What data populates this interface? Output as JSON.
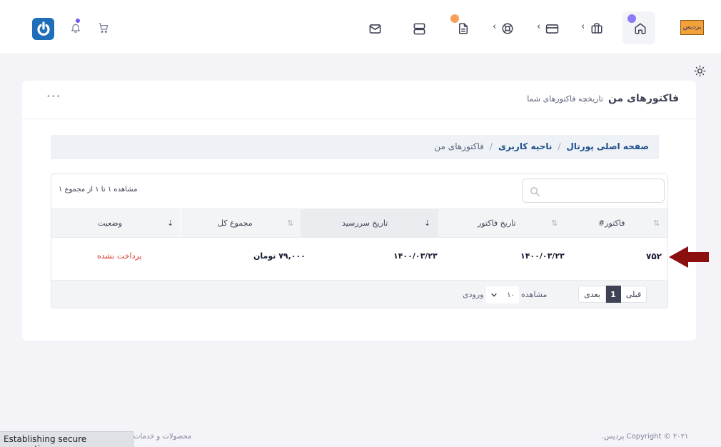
{
  "header": {
    "brand_logo_text": "پردیس",
    "badge_home_color": "#8b7cf6",
    "badge_invoice_color": "#f6a15b",
    "badge_bell_color": "#6a5cf2",
    "power_button_color": "#1e6fb8",
    "chevron": "‹"
  },
  "page": {
    "title": "فاکتورهای من",
    "subtitle": "تاریخچه فاکتورهای شما",
    "more_label": "•••"
  },
  "breadcrumb": {
    "items": [
      "صفحه اصلی پورتال",
      "ناحیه کاربری",
      "فاکتورهای من"
    ],
    "separator": "/"
  },
  "table": {
    "search_placeholder": "",
    "info": "مشاهده ۱ تا ۱ از مجموع ۱",
    "columns": [
      "فاکتور#",
      "تاریخ فاکتور",
      "تاریخ سررسید",
      "مجموع کل",
      "وضعیت"
    ],
    "sort_icons": [
      "⇅",
      "⇅",
      "⇣",
      "⇅",
      "⇣"
    ],
    "rows": [
      {
        "invoice": "۷۵۲",
        "invoice_date": "۱۴۰۰/۰۳/۲۳",
        "due_date": "۱۴۰۰/۰۳/۲۳",
        "total": "۷۹,۰۰۰ تومان",
        "status": "پرداخت نشده",
        "status_color": "#d9342b"
      }
    ]
  },
  "pagination": {
    "prev": "قبلی",
    "current": "1",
    "next": "بعدی",
    "show_label": "مشاهده",
    "page_size": "۱۰",
    "entries_label": "ورودی"
  },
  "footer": {
    "copyright": "۲۰۲۱ © Copyright پردیس.",
    "links": "محصولات و خدمات"
  },
  "status_bar": "Establishing secure connection...",
  "annotation_arrow_color": "#8b0f0f"
}
